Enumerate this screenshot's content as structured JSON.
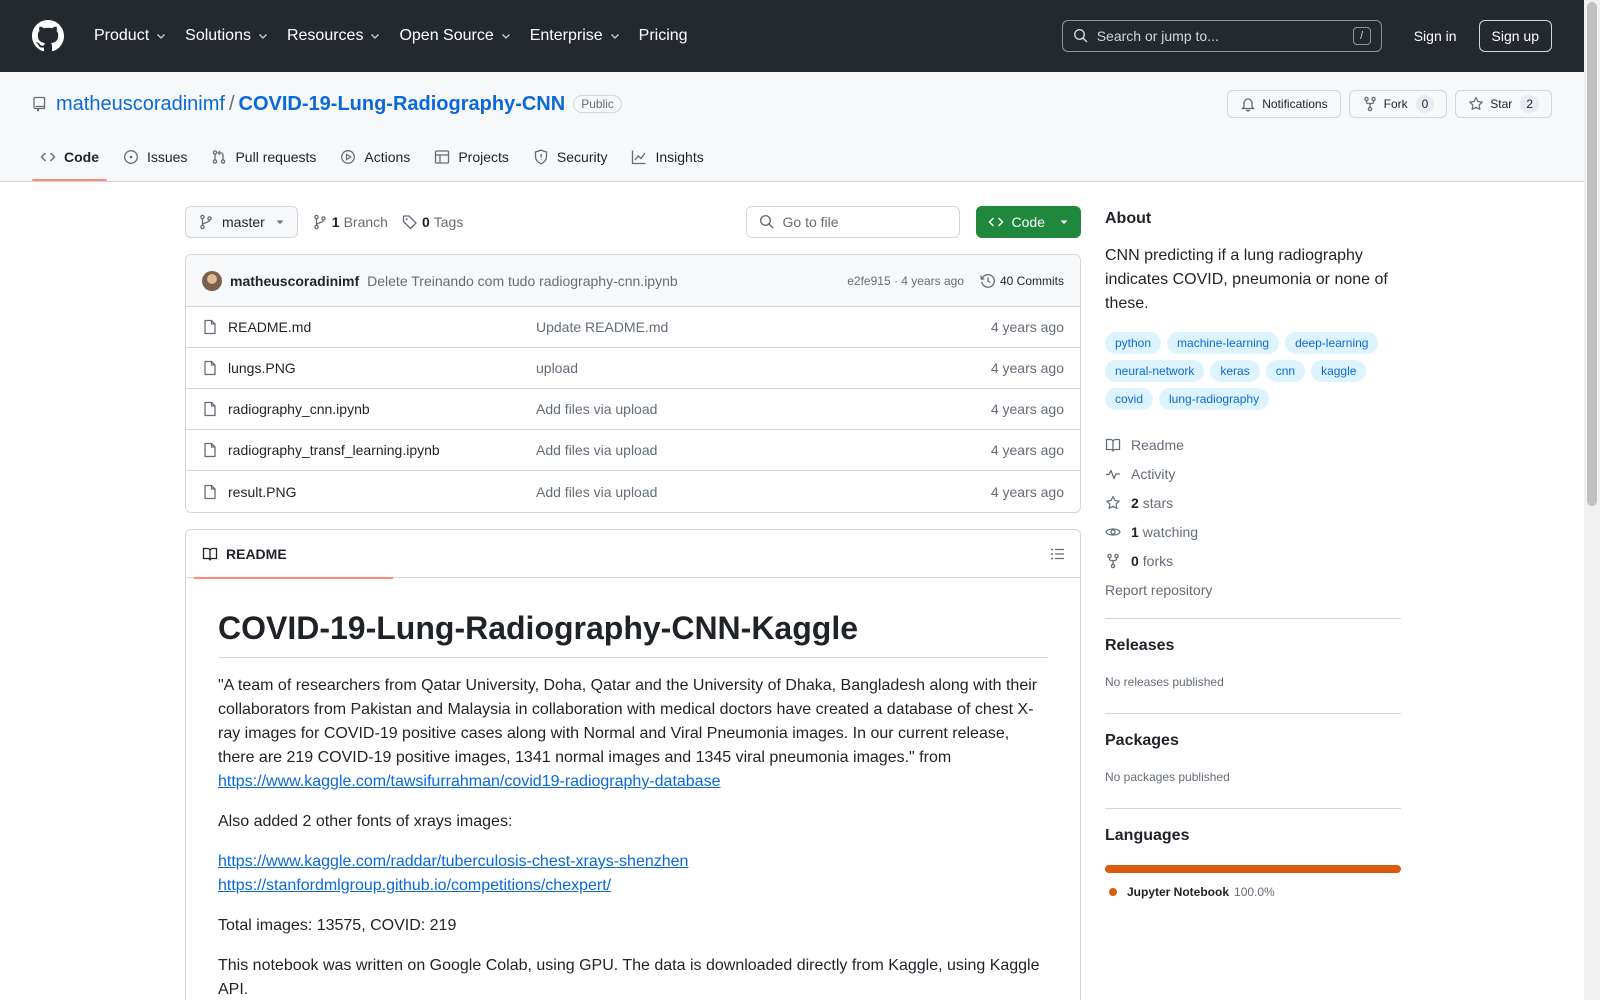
{
  "header": {
    "nav": [
      {
        "label": "Product",
        "dropdown": true
      },
      {
        "label": "Solutions",
        "dropdown": true
      },
      {
        "label": "Resources",
        "dropdown": true
      },
      {
        "label": "Open Source",
        "dropdown": true
      },
      {
        "label": "Enterprise",
        "dropdown": true
      },
      {
        "label": "Pricing",
        "dropdown": false
      }
    ],
    "search_placeholder": "Search or jump to...",
    "search_key": "/",
    "signin": "Sign in",
    "signup": "Sign up"
  },
  "repo": {
    "owner": "matheuscoradinimf",
    "separator": "/",
    "name": "COVID-19-Lung-Radiography-CNN",
    "visibility": "Public",
    "notifications_label": "Notifications",
    "fork_label": "Fork",
    "fork_count": "0",
    "star_label": "Star",
    "star_count": "2"
  },
  "tabs": [
    {
      "label": "Code",
      "icon": "code-icon",
      "active": true
    },
    {
      "label": "Issues",
      "icon": "issue-icon",
      "active": false
    },
    {
      "label": "Pull requests",
      "icon": "pull-request-icon",
      "active": false
    },
    {
      "label": "Actions",
      "icon": "play-icon",
      "active": false
    },
    {
      "label": "Projects",
      "icon": "table-icon",
      "active": false
    },
    {
      "label": "Security",
      "icon": "shield-icon",
      "active": false
    },
    {
      "label": "Insights",
      "icon": "graph-icon",
      "active": false
    }
  ],
  "toolbar": {
    "branch": "master",
    "branch_count": "1",
    "branch_label": "Branch",
    "tag_count": "0",
    "tag_label": "Tags",
    "goto_placeholder": "Go to file",
    "code_button": "Code"
  },
  "commit": {
    "author": "matheuscoradinimf",
    "message": "Delete Treinando com tudo radiography-cnn.ipynb",
    "meta": "e2fe915 · 4 years ago",
    "count_label": "40 Commits"
  },
  "files": [
    {
      "name": "README.md",
      "message": "Update README.md",
      "date": "4 years ago"
    },
    {
      "name": "lungs.PNG",
      "message": "upload",
      "date": "4 years ago"
    },
    {
      "name": "radiography_cnn.ipynb",
      "message": "Add files via upload",
      "date": "4 years ago"
    },
    {
      "name": "radiography_transf_learning.ipynb",
      "message": "Add files via upload",
      "date": "4 years ago"
    },
    {
      "name": "result.PNG",
      "message": "Add files via upload",
      "date": "4 years ago"
    }
  ],
  "readme": {
    "tab_label": "README",
    "title": "COVID-19-Lung-Radiography-CNN-Kaggle",
    "p1": "\"A team of researchers from Qatar University, Doha, Qatar and the University of Dhaka, Bangladesh along with their collaborators from Pakistan and Malaysia in collaboration with medical doctors have created a database of chest X-ray images for COVID-19 positive cases along with Normal and Viral Pneumonia images. In our current release, there are 219 COVID-19 positive images, 1341 normal images and 1345 viral pneumonia images.\" from",
    "link1": "https://www.kaggle.com/tawsifurrahman/covid19-radiography-database",
    "p2": "Also added 2 other fonts of xrays images:",
    "link2": "https://www.kaggle.com/raddar/tuberculosis-chest-xrays-shenzhen",
    "link3": "https://stanfordmlgroup.github.io/competitions/chexpert/",
    "p3": "Total images: 13575, COVID: 219",
    "p4": "This notebook was written on Google Colab, using GPU. The data is downloaded directly from Kaggle, using Kaggle API."
  },
  "sidebar": {
    "about_title": "About",
    "description": "CNN predicting if a lung radiography indicates COVID, pneumonia or none of these.",
    "topics": [
      "python",
      "machine-learning",
      "deep-learning",
      "neural-network",
      "keras",
      "cnn",
      "kaggle",
      "covid",
      "lung-radiography"
    ],
    "readme": "Readme",
    "activity": "Activity",
    "stars_count": "2",
    "stars_label": "stars",
    "watching_count": "1",
    "watching_label": "watching",
    "forks_count": "0",
    "forks_label": "forks",
    "report": "Report repository",
    "releases_title": "Releases",
    "releases_empty": "No releases published",
    "packages_title": "Packages",
    "packages_empty": "No packages published",
    "languages_title": "Languages",
    "languages": [
      {
        "name": "Jupyter Notebook",
        "percent": "100.0%",
        "color": "#DA5B0B",
        "share": 1.0
      }
    ]
  }
}
